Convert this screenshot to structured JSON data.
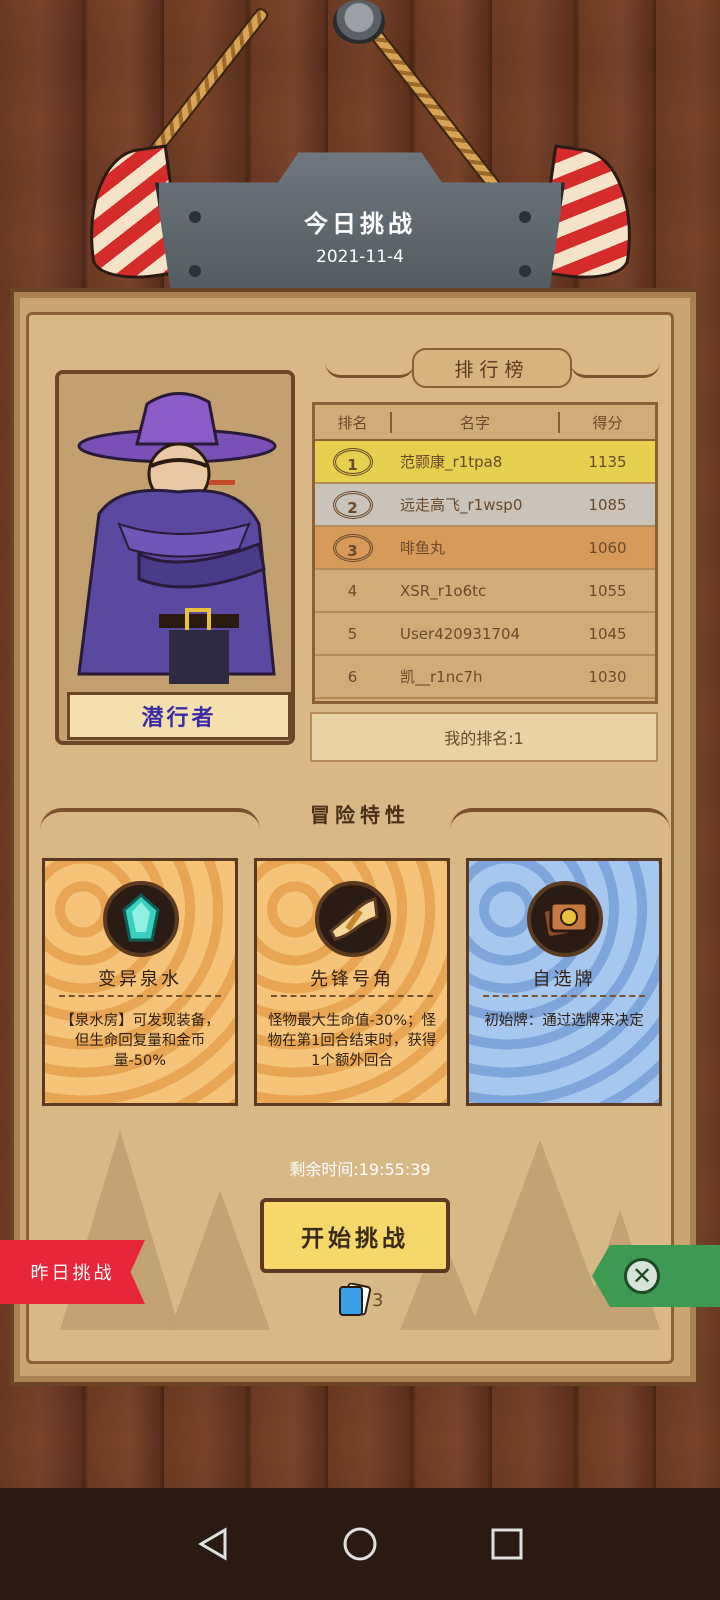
{
  "sign": {
    "title": "今日挑战",
    "date": "2021-11-4"
  },
  "character": {
    "name": "潜行者"
  },
  "leaderboard": {
    "title": "排行榜",
    "headers": [
      "排名",
      "名字",
      "得分"
    ],
    "rows": [
      {
        "rank": "1",
        "name": "范颢康_r1tpa8",
        "score": "1135",
        "badge_color": "#e7cf4f"
      },
      {
        "rank": "2",
        "name": "远走高飞_r1wsp0",
        "score": "1085",
        "badge_color": "#c9c3b9"
      },
      {
        "rank": "3",
        "name": "啡鱼丸",
        "score": "1060",
        "badge_color": "#d79a58"
      },
      {
        "rank": "4",
        "name": "XSR_r1o6tc",
        "score": "1055",
        "badge_color": ""
      },
      {
        "rank": "5",
        "name": "User420931704",
        "score": "1045",
        "badge_color": ""
      },
      {
        "rank": "6",
        "name": "凯__r1nc7h",
        "score": "1030",
        "badge_color": ""
      }
    ],
    "my_rank": "我的排名:1"
  },
  "traits": {
    "title": "冒险特性",
    "cards": [
      {
        "name": "变异泉水",
        "desc": "【泉水房】可发现装备，但生命回复量和金币量-50%",
        "icon": "crystal-icon",
        "theme": "orange"
      },
      {
        "name": "先锋号角",
        "desc": "怪物最大生命值-30%；怪物在第1回合结束时，获得1个额外回合",
        "icon": "horn-icon",
        "theme": "orange"
      },
      {
        "name": "自选牌",
        "desc": "初始牌：通过选牌来决定",
        "icon": "cards-icon",
        "theme": "blue"
      }
    ]
  },
  "footer": {
    "remaining_time": "剩余时间:19:55:39",
    "start_button": "开始挑战",
    "cards_count": "3",
    "yesterday_button": "昨日挑战"
  }
}
